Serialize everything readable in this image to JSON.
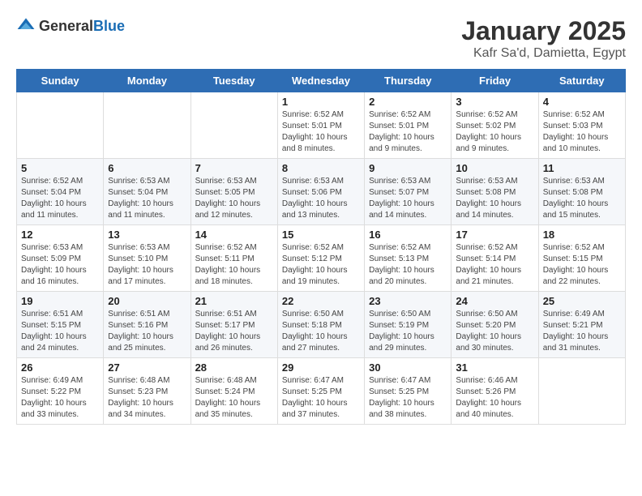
{
  "logo": {
    "text_general": "General",
    "text_blue": "Blue"
  },
  "title": "January 2025",
  "location": "Kafr Sa'd, Damietta, Egypt",
  "days_of_week": [
    "Sunday",
    "Monday",
    "Tuesday",
    "Wednesday",
    "Thursday",
    "Friday",
    "Saturday"
  ],
  "weeks": [
    [
      {
        "day": "",
        "info": ""
      },
      {
        "day": "",
        "info": ""
      },
      {
        "day": "",
        "info": ""
      },
      {
        "day": "1",
        "info": "Sunrise: 6:52 AM\nSunset: 5:01 PM\nDaylight: 10 hours\nand 8 minutes."
      },
      {
        "day": "2",
        "info": "Sunrise: 6:52 AM\nSunset: 5:01 PM\nDaylight: 10 hours\nand 9 minutes."
      },
      {
        "day": "3",
        "info": "Sunrise: 6:52 AM\nSunset: 5:02 PM\nDaylight: 10 hours\nand 9 minutes."
      },
      {
        "day": "4",
        "info": "Sunrise: 6:52 AM\nSunset: 5:03 PM\nDaylight: 10 hours\nand 10 minutes."
      }
    ],
    [
      {
        "day": "5",
        "info": "Sunrise: 6:52 AM\nSunset: 5:04 PM\nDaylight: 10 hours\nand 11 minutes."
      },
      {
        "day": "6",
        "info": "Sunrise: 6:53 AM\nSunset: 5:04 PM\nDaylight: 10 hours\nand 11 minutes."
      },
      {
        "day": "7",
        "info": "Sunrise: 6:53 AM\nSunset: 5:05 PM\nDaylight: 10 hours\nand 12 minutes."
      },
      {
        "day": "8",
        "info": "Sunrise: 6:53 AM\nSunset: 5:06 PM\nDaylight: 10 hours\nand 13 minutes."
      },
      {
        "day": "9",
        "info": "Sunrise: 6:53 AM\nSunset: 5:07 PM\nDaylight: 10 hours\nand 14 minutes."
      },
      {
        "day": "10",
        "info": "Sunrise: 6:53 AM\nSunset: 5:08 PM\nDaylight: 10 hours\nand 14 minutes."
      },
      {
        "day": "11",
        "info": "Sunrise: 6:53 AM\nSunset: 5:08 PM\nDaylight: 10 hours\nand 15 minutes."
      }
    ],
    [
      {
        "day": "12",
        "info": "Sunrise: 6:53 AM\nSunset: 5:09 PM\nDaylight: 10 hours\nand 16 minutes."
      },
      {
        "day": "13",
        "info": "Sunrise: 6:53 AM\nSunset: 5:10 PM\nDaylight: 10 hours\nand 17 minutes."
      },
      {
        "day": "14",
        "info": "Sunrise: 6:52 AM\nSunset: 5:11 PM\nDaylight: 10 hours\nand 18 minutes."
      },
      {
        "day": "15",
        "info": "Sunrise: 6:52 AM\nSunset: 5:12 PM\nDaylight: 10 hours\nand 19 minutes."
      },
      {
        "day": "16",
        "info": "Sunrise: 6:52 AM\nSunset: 5:13 PM\nDaylight: 10 hours\nand 20 minutes."
      },
      {
        "day": "17",
        "info": "Sunrise: 6:52 AM\nSunset: 5:14 PM\nDaylight: 10 hours\nand 21 minutes."
      },
      {
        "day": "18",
        "info": "Sunrise: 6:52 AM\nSunset: 5:15 PM\nDaylight: 10 hours\nand 22 minutes."
      }
    ],
    [
      {
        "day": "19",
        "info": "Sunrise: 6:51 AM\nSunset: 5:15 PM\nDaylight: 10 hours\nand 24 minutes."
      },
      {
        "day": "20",
        "info": "Sunrise: 6:51 AM\nSunset: 5:16 PM\nDaylight: 10 hours\nand 25 minutes."
      },
      {
        "day": "21",
        "info": "Sunrise: 6:51 AM\nSunset: 5:17 PM\nDaylight: 10 hours\nand 26 minutes."
      },
      {
        "day": "22",
        "info": "Sunrise: 6:50 AM\nSunset: 5:18 PM\nDaylight: 10 hours\nand 27 minutes."
      },
      {
        "day": "23",
        "info": "Sunrise: 6:50 AM\nSunset: 5:19 PM\nDaylight: 10 hours\nand 29 minutes."
      },
      {
        "day": "24",
        "info": "Sunrise: 6:50 AM\nSunset: 5:20 PM\nDaylight: 10 hours\nand 30 minutes."
      },
      {
        "day": "25",
        "info": "Sunrise: 6:49 AM\nSunset: 5:21 PM\nDaylight: 10 hours\nand 31 minutes."
      }
    ],
    [
      {
        "day": "26",
        "info": "Sunrise: 6:49 AM\nSunset: 5:22 PM\nDaylight: 10 hours\nand 33 minutes."
      },
      {
        "day": "27",
        "info": "Sunrise: 6:48 AM\nSunset: 5:23 PM\nDaylight: 10 hours\nand 34 minutes."
      },
      {
        "day": "28",
        "info": "Sunrise: 6:48 AM\nSunset: 5:24 PM\nDaylight: 10 hours\nand 35 minutes."
      },
      {
        "day": "29",
        "info": "Sunrise: 6:47 AM\nSunset: 5:25 PM\nDaylight: 10 hours\nand 37 minutes."
      },
      {
        "day": "30",
        "info": "Sunrise: 6:47 AM\nSunset: 5:25 PM\nDaylight: 10 hours\nand 38 minutes."
      },
      {
        "day": "31",
        "info": "Sunrise: 6:46 AM\nSunset: 5:26 PM\nDaylight: 10 hours\nand 40 minutes."
      },
      {
        "day": "",
        "info": ""
      }
    ]
  ]
}
